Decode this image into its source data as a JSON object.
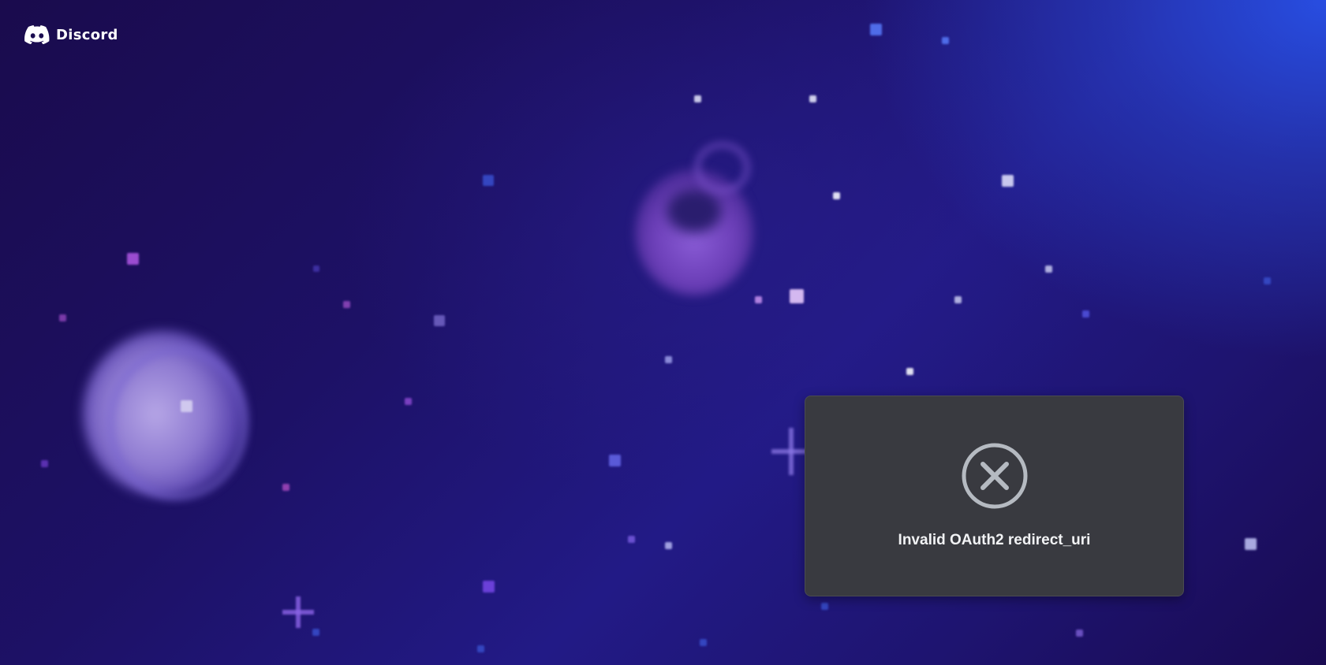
{
  "header": {
    "brand_name": "Discord",
    "logo_icon": "discord-logo-icon"
  },
  "error_card": {
    "icon": "close-circle-icon",
    "message": "Invalid OAuth2 redirect_uri"
  },
  "colors": {
    "background_dark": "#1a0b4d",
    "background_highlight": "#2850e6",
    "card_background": "#393a40",
    "icon_color": "#b5bac1",
    "text_color": "#f2f3f5"
  }
}
